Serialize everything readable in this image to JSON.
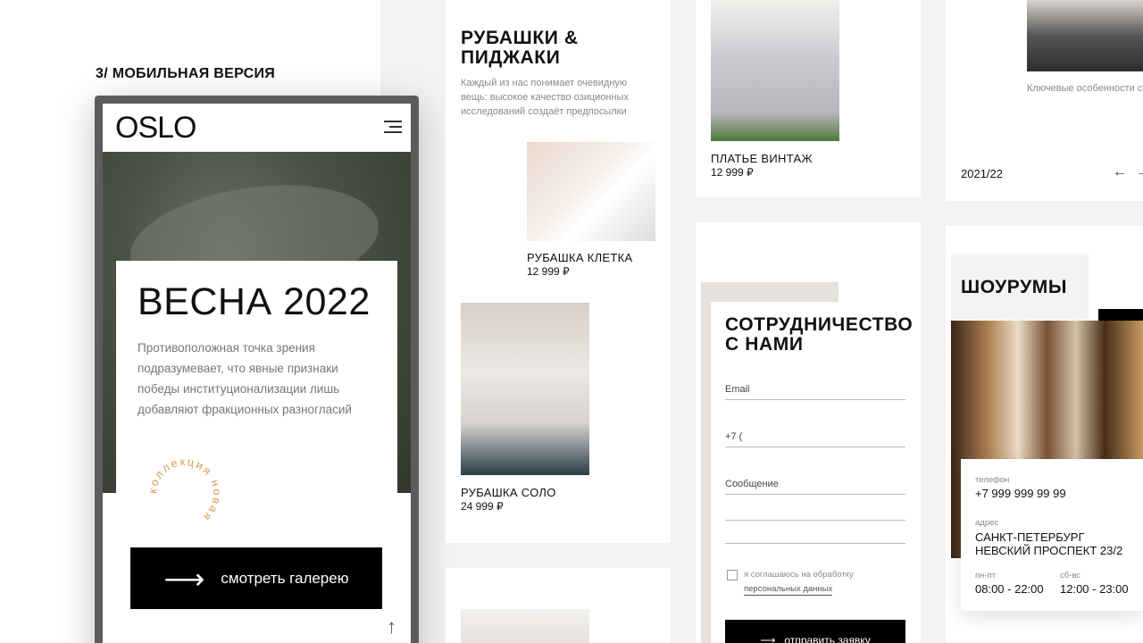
{
  "section": {
    "heading": "3/ МОБИЛЬНАЯ ВЕРСИЯ"
  },
  "phone": {
    "logo": "OSLO",
    "hero_title": "ВЕСНА 2022",
    "hero_description": "Противоположная точка зрения подразумевает, что явные признаки победы институционализации лишь добавляют фракционных разногласий",
    "stamp_text": "коллекция новая",
    "cta_label": "смотреть галерею"
  },
  "shirts": {
    "title_line1": "РУБАШКИ &",
    "title_line2": "ПИДЖАКИ",
    "description": "Каждый из нас понимает очевидную вещь: высокое качество озиционных исследований создаёт предпосылки",
    "products": [
      {
        "name": "РУБАШКА КЛЕТКА",
        "price": "12 999 ₽"
      },
      {
        "name": "РУБАШКА СОЛО",
        "price": "24 999 ₽"
      }
    ]
  },
  "dress": {
    "name": "ПЛАТЬЕ ВИНТАЖ",
    "price": "12 999 ₽"
  },
  "form": {
    "title_line1": "СОТРУДНИЧЕСТВО",
    "title_line2": "С НАМИ",
    "email_label": "Email",
    "phone_value": "+7 (",
    "message_label": "Сообщение",
    "consent_text": "я соглашаюсь на обработку",
    "consent_link": "персональных данных",
    "submit_label": "отправить заявку"
  },
  "collection": {
    "description": "Ключевые особенности структуры проекта являются только методом политического участия и описаны",
    "season": "2021/22"
  },
  "showrooms": {
    "title": "ШОУРУМЫ",
    "phone_label": "телефон",
    "phone_value": "+7 999 999 99 99",
    "address_label": "адрес",
    "address_line1": "САНКТ-ПЕТЕРБУРГ",
    "address_line2": "НЕВСКИЙ ПРОСПЕКТ 23/2",
    "weekday_label": "пн-пт",
    "weekday_hours": "08:00 - 22:00",
    "weekend_label": "сб-вс",
    "weekend_hours": "12:00 - 23:00"
  },
  "colors": {
    "accent_orange": "#d99a4e",
    "black": "#000000",
    "panel_bg": "#f3f3f5"
  }
}
